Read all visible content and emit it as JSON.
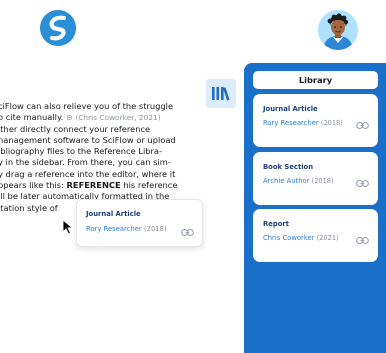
{
  "header": {
    "logo_icon": "sciflow-logo-icon",
    "avatar_icon": "user-avatar-icon"
  },
  "editor": {
    "lines": {
      "l1": "ciFlow can also relieve you of the struggle",
      "l2_a": "o cite manually.",
      "l2_cite": "(Chris Coworker, 2021)",
      "l3": "ither directly connect your reference",
      "l4": "nanagement software to SciFlow or upload",
      "l5": "ibliography files to the Reference Libra-",
      "l6": "y in the sidebar. From there, you can sim-",
      "l7": "y drag a reference into the editor, where it",
      "l8_a": "ppears like this:",
      "l8_b": "REFERENCE",
      "l8_c": "his reference",
      "l9": "ill be later automatically formatted in the",
      "l10": "itation style of"
    },
    "link_glyph": "⊖"
  },
  "citation_popup": {
    "type": "Journal Article",
    "author": "Rory Researcher",
    "year": "(2018)"
  },
  "library": {
    "title": "Library",
    "items": [
      {
        "type": "Journal Article",
        "author": "Rory Researcher",
        "year": "(2018)"
      },
      {
        "type": "Book Section",
        "author": "Archie Author",
        "year": "(2018)"
      },
      {
        "type": "Report",
        "author": "Chris Coworker",
        "year": "(2021)"
      }
    ]
  },
  "colors": {
    "panel": "#1a6fc9",
    "accent": "#2a7fd1",
    "title_text": "#1a3f7a"
  }
}
